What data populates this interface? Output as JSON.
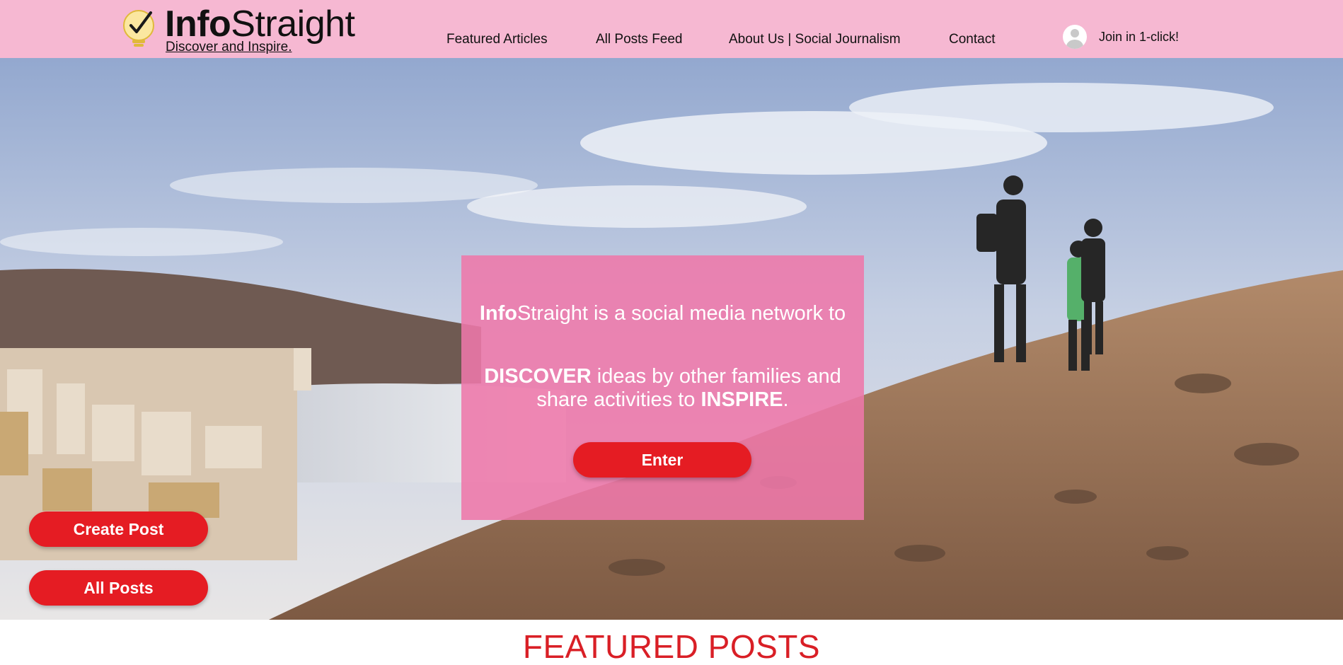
{
  "header": {
    "brand_bold": "Info",
    "brand_light": "Straight",
    "tagline": "Discover and Inspire.",
    "nav": [
      {
        "label": "Featured Articles"
      },
      {
        "label": "All Posts Feed"
      },
      {
        "label": "About Us | Social Journalism"
      },
      {
        "label": "Contact"
      }
    ],
    "join_label": "Join in 1-click!",
    "logo_icon": "lightbulb-check-icon",
    "avatar_icon": "user-avatar-icon"
  },
  "hero": {
    "line1_bold": "Info",
    "line1_rest": "Straight is a social media network to",
    "line2_bold1": "DISCOVER",
    "line2_mid": " ideas by other families and share activities to ",
    "line2_bold2": "INSPIRE",
    "line2_end": ".",
    "enter_label": "Enter",
    "create_post_label": "Create Post",
    "all_posts_label": "All Posts"
  },
  "section": {
    "featured_title": "FEATURED POSTS"
  },
  "colors": {
    "header_bg": "#f6b8d2",
    "cta_box": "#ee78aa",
    "button_red": "#e51c23",
    "featured_title": "#d91f26"
  }
}
